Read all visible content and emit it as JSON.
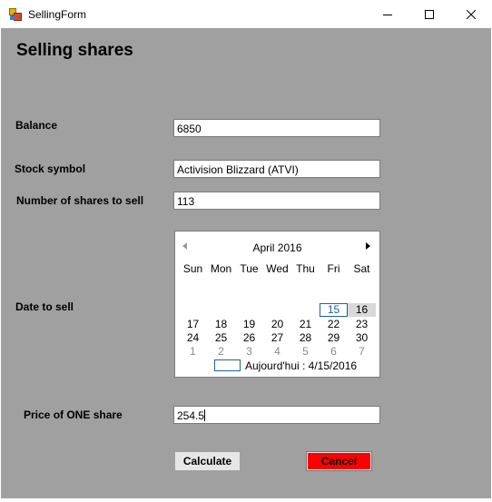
{
  "window": {
    "title": "SellingForm",
    "icon": "form-app-icon",
    "controls": [
      "minimize-icon",
      "maximize-icon",
      "close-icon"
    ]
  },
  "form": {
    "heading": "Selling shares",
    "balance": {
      "label": "Balance",
      "value": "6850"
    },
    "stock_symbol": {
      "label": "Stock symbol",
      "value": "Activision Blizzard (ATVI)"
    },
    "shares_to_sell": {
      "label": "Number of shares to sell",
      "value": "113"
    },
    "date_to_sell": {
      "label": "Date to sell"
    },
    "price_one_share": {
      "label": "Price of ONE share",
      "value": "254.5"
    },
    "calculate_button": "Calculate",
    "cancel_button": "Cancel"
  },
  "calendar": {
    "month_label": "April 2016",
    "weekdays": [
      "Sun",
      "Mon",
      "Tue",
      "Wed",
      "Thu",
      "Fri",
      "Sat"
    ],
    "weeks": [
      [
        "",
        "",
        "",
        "",
        "",
        "15",
        "16"
      ],
      [
        "17",
        "18",
        "19",
        "20",
        "21",
        "22",
        "23"
      ],
      [
        "24",
        "25",
        "26",
        "27",
        "28",
        "29",
        "30"
      ],
      [
        "1",
        "2",
        "3",
        "4",
        "5",
        "6",
        "7"
      ]
    ],
    "today_day": "15",
    "selected_day": "16",
    "next_month_row": 3,
    "today_text": "Aujourd'hui : 4/15/2016"
  },
  "colors": {
    "form_background": "#a0a0a0",
    "cancel_button": "#ff0000",
    "calculate_button": "#e6e6e6",
    "today_highlight": "#1f5fa3",
    "selected_day_background": "#d9d9d9"
  }
}
